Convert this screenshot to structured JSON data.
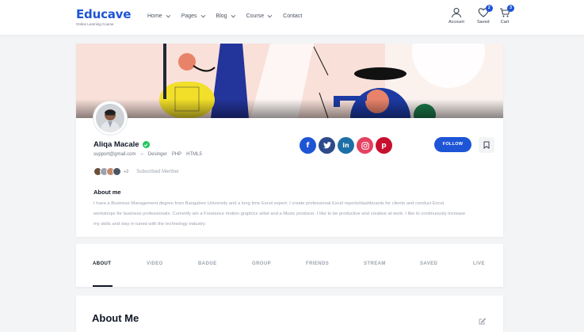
{
  "brand": {
    "name": "Educave",
    "tagline": "Online Learning Course",
    "accent": "#1e55d6"
  },
  "nav": [
    {
      "label": "Home",
      "has_dropdown": true
    },
    {
      "label": "Pages",
      "has_dropdown": true
    },
    {
      "label": "Blog",
      "has_dropdown": true
    },
    {
      "label": "Course",
      "has_dropdown": true
    },
    {
      "label": "Contact",
      "has_dropdown": false
    }
  ],
  "header_icons": {
    "account": {
      "label": "Account",
      "icon": "user-icon"
    },
    "saved": {
      "label": "Saved",
      "icon": "heart-icon",
      "count": "2"
    },
    "cart": {
      "label": "Cart",
      "icon": "cart-icon",
      "count": "3"
    }
  },
  "profile": {
    "name": "Aliqa Macale",
    "verified": true,
    "email": "support@gmail.com",
    "separator": "–",
    "role": "Desinger",
    "skills": [
      "PHP",
      "HTML5"
    ],
    "members_more": "+2",
    "members_label": "Subscribed Member",
    "about_title": "About me",
    "about_text": "I have a Business Management degree from Bangalore University and a long time Excel expert. I create professional Excel reports/dashboards for clients and conduct Excel workshops for business professionals. Currently am a Freelance motion graphics artist and a Music producer. I like to be productive and creative at work. I like to continuously increase my skills and stay in tuned with the technology industry.",
    "follow_label": "FOLLOW"
  },
  "socials": [
    {
      "name": "facebook",
      "glyph": "f",
      "color": "#1e55d6"
    },
    {
      "name": "twitter",
      "glyph": "t",
      "color": "#2d4a8a"
    },
    {
      "name": "linkedin",
      "glyph": "in",
      "color": "#1d6fa8"
    },
    {
      "name": "instagram",
      "glyph": "ig",
      "color": "#e4405f"
    },
    {
      "name": "pinterest",
      "glyph": "p",
      "color": "#c8102e"
    }
  ],
  "tabs": [
    "ABOUT",
    "VIDEO",
    "BADGE",
    "GROUP",
    "FRIENDS",
    "STREAM",
    "SAVED",
    "LIVE"
  ],
  "active_tab": "ABOUT",
  "about_me_section": {
    "title": "About Me"
  }
}
